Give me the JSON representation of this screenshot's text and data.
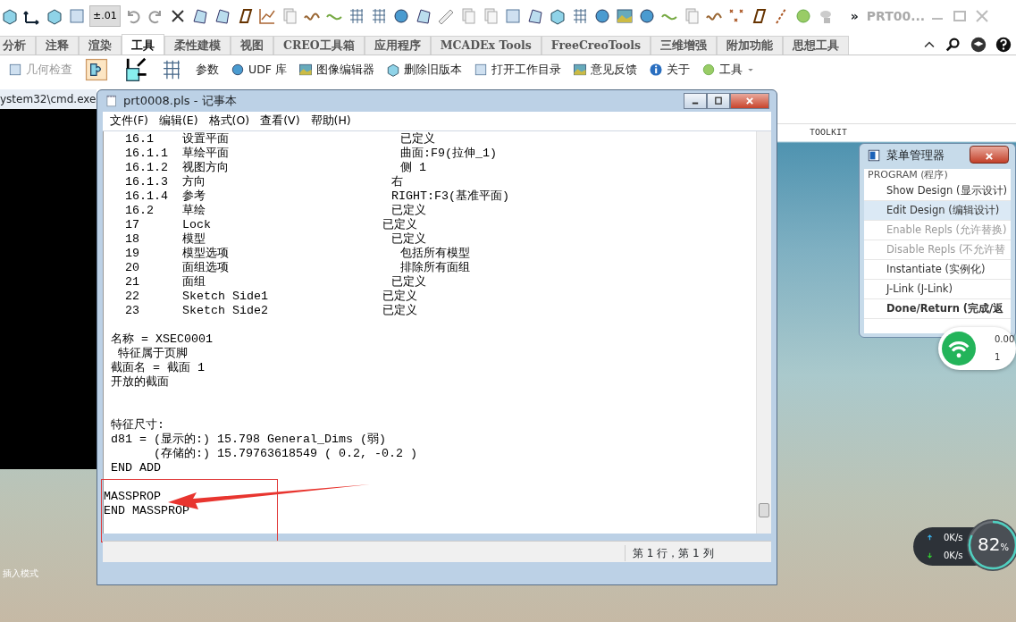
{
  "app_toolbar": {
    "value_button": "±.01",
    "overflow": "»",
    "window_title": "PRT00..."
  },
  "ribbon": {
    "tabs": [
      {
        "label": "分析",
        "selected": false
      },
      {
        "label": "注释",
        "selected": false
      },
      {
        "label": "渲染",
        "selected": false
      },
      {
        "label": "工具",
        "selected": true
      },
      {
        "label": "柔性建模",
        "selected": false
      },
      {
        "label": "视图",
        "selected": false
      },
      {
        "label": "CREO工具箱",
        "selected": false
      },
      {
        "label": "应用程序",
        "selected": false
      },
      {
        "label": "MCADEx Tools",
        "selected": false
      },
      {
        "label": "FreeCreoTools",
        "selected": false
      },
      {
        "label": "三维增强",
        "selected": false
      },
      {
        "label": "附加功能",
        "selected": false
      },
      {
        "label": "思想工具",
        "selected": false
      }
    ],
    "commands": [
      {
        "label": "几何检查",
        "disabled": true
      },
      {
        "label": "参数",
        "disabled": false
      },
      {
        "label": "UDF 库",
        "disabled": false
      },
      {
        "label": "图像编辑器",
        "disabled": false
      },
      {
        "label": "删除旧版本",
        "disabled": false
      },
      {
        "label": "打开工作目录",
        "disabled": false
      },
      {
        "label": "意见反馈",
        "disabled": false
      },
      {
        "label": "关于",
        "disabled": false
      },
      {
        "label": "工具",
        "disabled": false
      }
    ],
    "group_label": "TOOLKIT"
  },
  "cmd_window": {
    "title": "ystem32\\cmd.exe"
  },
  "notepad": {
    "title": "prt0008.pls - 记事本",
    "menu": [
      "文件(F)",
      "编辑(E)",
      "格式(O)",
      "查看(V)",
      "帮助(H)"
    ],
    "blocks": [
      [
        "   16.1    设置平面                        已定义",
        "   16.1.1  草绘平面                        曲面:F9(拉伸_1)",
        "   16.1.2  视图方向                        侧 1",
        "   16.1.3  方向                          右",
        "   16.1.4  参考                          RIGHT:F3(基准平面)",
        "   16.2    草绘                          已定义",
        "   17      Lock                        已定义",
        "   18      模型                          已定义",
        "   19      模型选项                        包括所有模型",
        "   20      面组选项                        排除所有面组",
        "   21      面组                          已定义",
        "   22      Sketch Side1                已定义",
        "   23      Sketch Side2                已定义"
      ],
      [
        " 名称 = XSEC0001",
        "  特征属于页脚",
        " 截面名 = 截面 1",
        " 开放的截面"
      ],
      [
        " 特征尺寸:",
        " d81 = (显示的:) 15.798 General_Dims (弱)",
        "       (存储的:) 15.79763618549 ( 0.2, -0.2 )",
        " END ADD"
      ],
      [
        "MASSPROP",
        "END MASSPROP"
      ]
    ],
    "status": "第 1 行，第 1 列"
  },
  "menu_manager": {
    "title": "菜单管理器",
    "header": "PROGRAM (程序)",
    "items": [
      {
        "label": "Show Design (显示设计)",
        "selected": false,
        "disabled": false,
        "emphasized": false
      },
      {
        "label": "Edit Design (编辑设计)",
        "selected": true,
        "disabled": false,
        "emphasized": false
      },
      {
        "label": "Enable Repls (允许替换)",
        "selected": false,
        "disabled": true,
        "emphasized": false
      },
      {
        "label": "Disable Repls (不允许替",
        "selected": false,
        "disabled": true,
        "emphasized": false
      },
      {
        "label": "Instantiate (实例化)",
        "selected": false,
        "disabled": false,
        "emphasized": false
      },
      {
        "label": "J-Link (J-Link)",
        "selected": false,
        "disabled": false,
        "emphasized": false
      },
      {
        "label": "Done/Return (完成/返",
        "selected": false,
        "disabled": false,
        "emphasized": true
      }
    ]
  },
  "network_widget": {
    "speed": "0.00",
    "count": "1"
  },
  "speed_meter": {
    "upload": "0K/s",
    "download": "0K/s",
    "percent": "82",
    "unit": "%",
    "level": 0.82
  },
  "mode_text": "插入模式"
}
